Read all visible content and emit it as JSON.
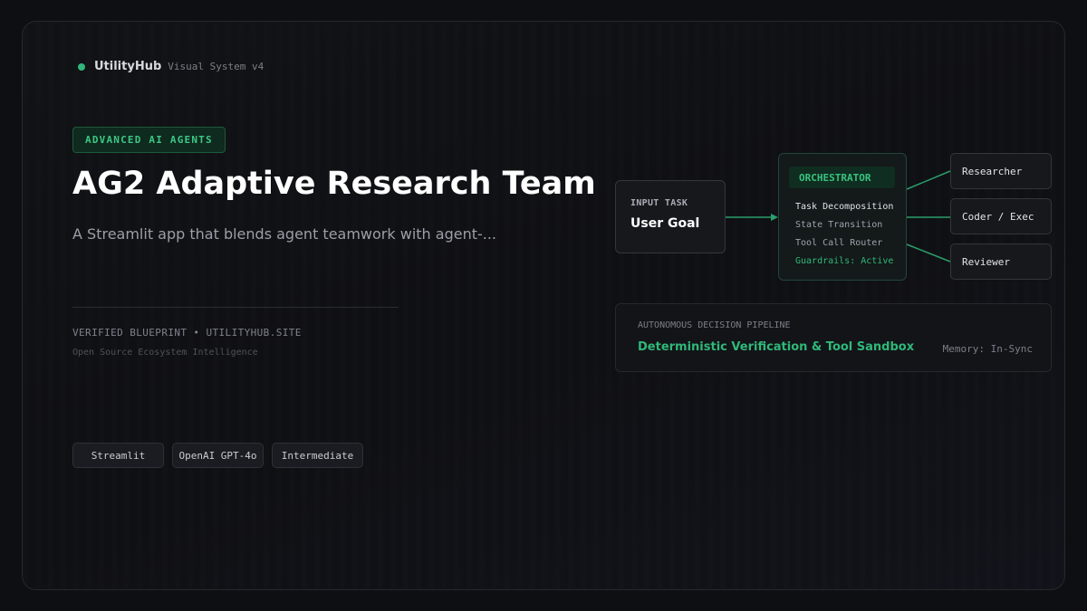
{
  "brand": {
    "name": "UtilityHub",
    "subtitle": "Visual System v4",
    "dot_color": "#2fb879"
  },
  "hero": {
    "category": "ADVANCED AI AGENTS",
    "title": "AG2 Adaptive Research Team",
    "description": "A Streamlit app that blends agent teamwork with agent-..."
  },
  "footer_meta": {
    "verified": "VERIFIED BLUEPRINT • UTILITYHUB.SITE",
    "ecosystem": "Open Source Ecosystem Intelligence"
  },
  "tags": [
    "Streamlit",
    "OpenAI GPT-4o",
    "Intermediate"
  ],
  "diagram": {
    "input": {
      "label": "INPUT TASK",
      "value": "User Goal"
    },
    "orchestrator": {
      "title": "ORCHESTRATOR",
      "items": [
        "Task Decomposition",
        "State Transition",
        "Tool Call Router",
        "Guardrails: Active"
      ]
    },
    "agents": [
      "Researcher",
      "Coder / Exec",
      "Reviewer"
    ],
    "pipeline": {
      "label": "AUTONOMOUS DECISION PIPELINE",
      "title": "Deterministic Verification & Tool Sandbox",
      "memory": "Memory: In-Sync"
    }
  },
  "colors": {
    "accent": "#2fb879",
    "background": "#0e0f12",
    "connector": "#2a9e6c"
  }
}
